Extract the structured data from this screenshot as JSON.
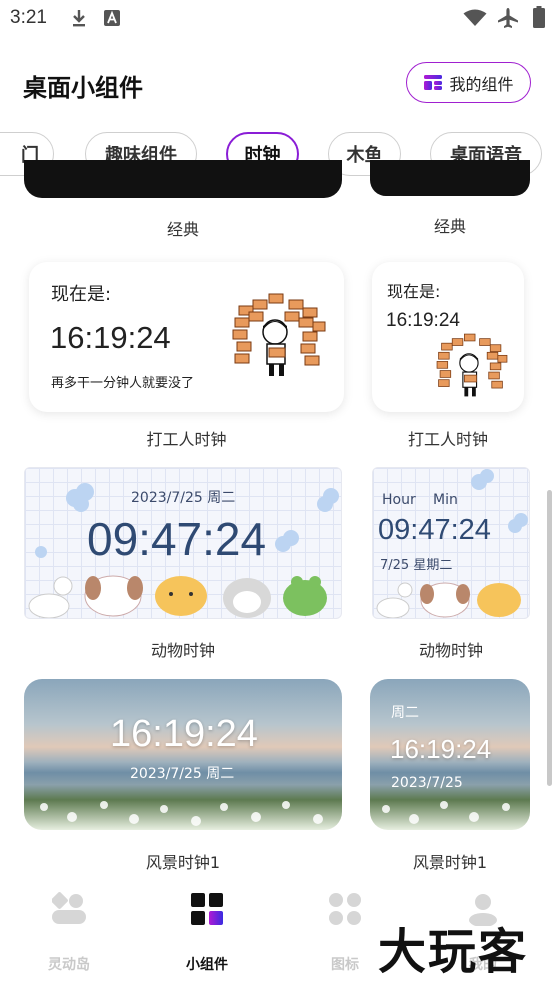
{
  "status_bar": {
    "time": "3:21"
  },
  "header": {
    "title": "桌面小组件",
    "my_widgets": "我的组件"
  },
  "tabs": [
    {
      "label": "门"
    },
    {
      "label": "趣味组件"
    },
    {
      "label": "时钟",
      "active": true
    },
    {
      "label": "木鱼"
    },
    {
      "label": "桌面语音"
    }
  ],
  "widgets": {
    "classic": {
      "caption_left": "经典",
      "caption_right": "经典"
    },
    "worker": {
      "caption_left": "打工人时钟",
      "caption_right": "打工人时钟",
      "left": {
        "prefix": "现在是:",
        "time": "16:19:24",
        "slogan": "再多干一分钟人就要没了"
      },
      "right": {
        "prefix": "现在是:",
        "time": "16:19:24"
      }
    },
    "animal": {
      "caption_left": "动物时钟",
      "caption_right": "动物时钟",
      "left": {
        "date": "2023/7/25 周二",
        "time": "09:47:24"
      },
      "right": {
        "hour_label": "Hour",
        "min_label": "Min",
        "time": "09:47:24",
        "date": "7/25 星期二"
      }
    },
    "scenery": {
      "caption_left": "风景时钟1",
      "caption_right": "风景时钟1",
      "left": {
        "time": "16:19:24",
        "date": "2023/7/25 周二"
      },
      "right": {
        "weekday": "周二",
        "time": "16:19:24",
        "date": "2023/7/25"
      }
    }
  },
  "bottom_nav": [
    {
      "label": "灵动岛",
      "icon": "island-icon"
    },
    {
      "label": "小组件",
      "icon": "widgets-icon",
      "active": true
    },
    {
      "label": "图标",
      "icon": "icons-grid-icon"
    },
    {
      "label": "我的",
      "icon": "profile-icon"
    }
  ],
  "watermark": "大玩客",
  "colors": {
    "accent": "#8a1dd6",
    "accent_gradient_end": "#3a2be0"
  }
}
